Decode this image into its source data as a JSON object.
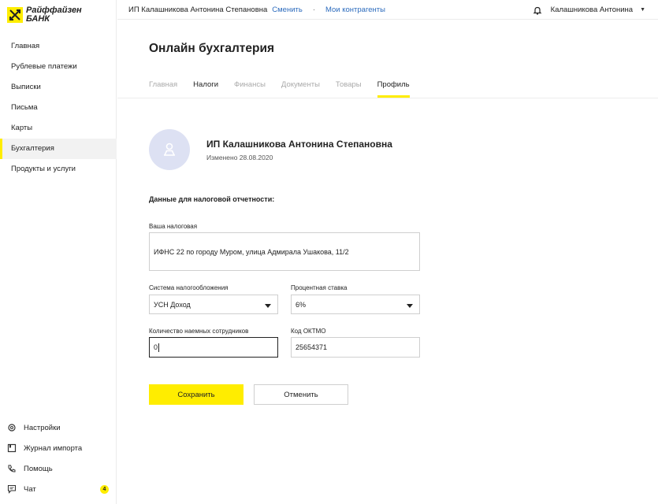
{
  "brand": {
    "line1": "Райффайзен",
    "line2": "БАНК",
    "accent": "#ffed00"
  },
  "sidebar": {
    "items": [
      {
        "label": "Главная"
      },
      {
        "label": "Рублевые платежи"
      },
      {
        "label": "Выписки"
      },
      {
        "label": "Письма"
      },
      {
        "label": "Карты"
      },
      {
        "label": "Бухгалтерия",
        "active": true
      },
      {
        "label": "Продукты и услуги"
      }
    ],
    "bottom": [
      {
        "label": "Настройки",
        "icon": "gear-icon"
      },
      {
        "label": "Журнал импорта",
        "icon": "import-journal-icon"
      },
      {
        "label": "Помощь",
        "icon": "phone-icon"
      },
      {
        "label": "Чат",
        "icon": "chat-icon",
        "badge": "4"
      }
    ]
  },
  "topbar": {
    "company": "ИП Калашникова Антонина Степановна",
    "change_link": "Сменить",
    "separator": "·",
    "counterparties_link": "Мои контрагенты",
    "user": "Калашникова Антонина",
    "link_color": "#2c6bbd"
  },
  "page": {
    "title": "Онлайн бухгалтерия",
    "tabs": [
      {
        "label": "Главная"
      },
      {
        "label": "Налоги"
      },
      {
        "label": "Финансы"
      },
      {
        "label": "Документы"
      },
      {
        "label": "Товары"
      },
      {
        "label": "Профиль",
        "active": true
      }
    ]
  },
  "profile": {
    "name": "ИП Калашникова Антонина Степановна",
    "changed": "Изменено 28.08.2020"
  },
  "form": {
    "section_title": "Данные для налоговой отчетности:",
    "tax_office_label": "Ваша налоговая",
    "tax_office_value": "ИФНС 22 по городу Муром, улица Адмирала Ушакова, 11/2",
    "tax_system_label": "Система налогообложения",
    "tax_system_value": "УСН Доход",
    "rate_label": "Процентная ставка",
    "rate_value": "6%",
    "employees_label": "Количество наемных сотрудников",
    "employees_value": "0",
    "oktmo_label": "Код ОКТМО",
    "oktmo_value": "25654371",
    "save_label": "Сохранить",
    "cancel_label": "Отменить"
  }
}
